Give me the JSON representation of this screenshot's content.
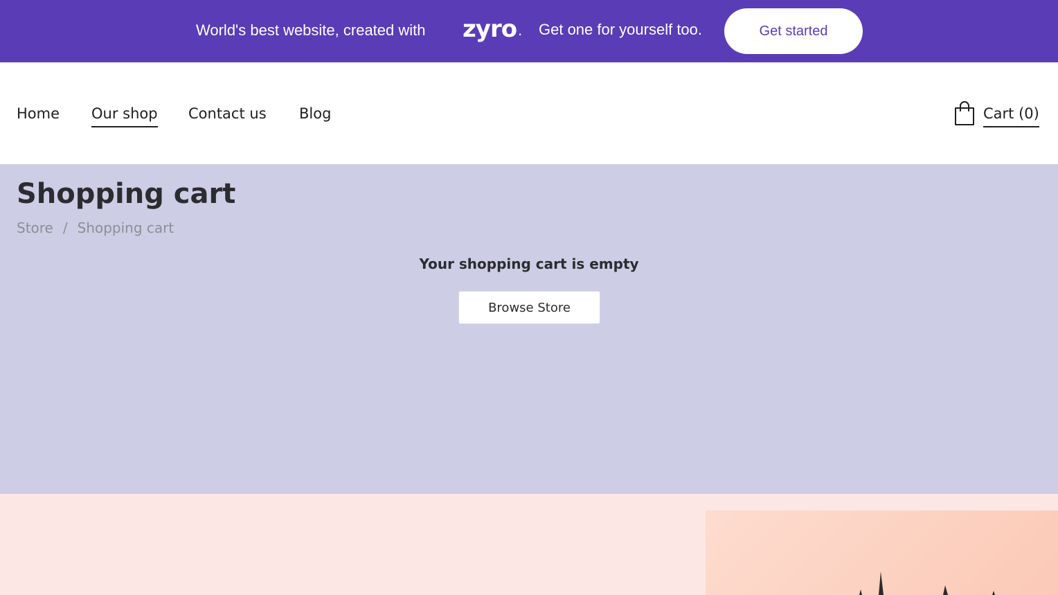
{
  "promo": {
    "text_before": "World's best website, created with",
    "logo": "zyro",
    "logo_dot": ".",
    "text_after": "Get one for yourself too.",
    "button_label": "Get started"
  },
  "nav": {
    "items": [
      {
        "label": "Home",
        "active": false
      },
      {
        "label": "Our shop",
        "active": true
      },
      {
        "label": "Contact us",
        "active": false
      },
      {
        "label": "Blog",
        "active": false
      }
    ],
    "cart_label": "Cart (0)"
  },
  "cart": {
    "title": "Shopping cart",
    "breadcrumb": {
      "parent": "Store",
      "separator": "/",
      "current": "Shopping cart"
    },
    "empty_message": "Your shopping cart is empty",
    "browse_button": "Browse Store"
  },
  "colors": {
    "promo_bg": "#5a3cb7",
    "cart_section_bg": "#cecde6",
    "bottom_section_bg": "#fde7e4"
  }
}
